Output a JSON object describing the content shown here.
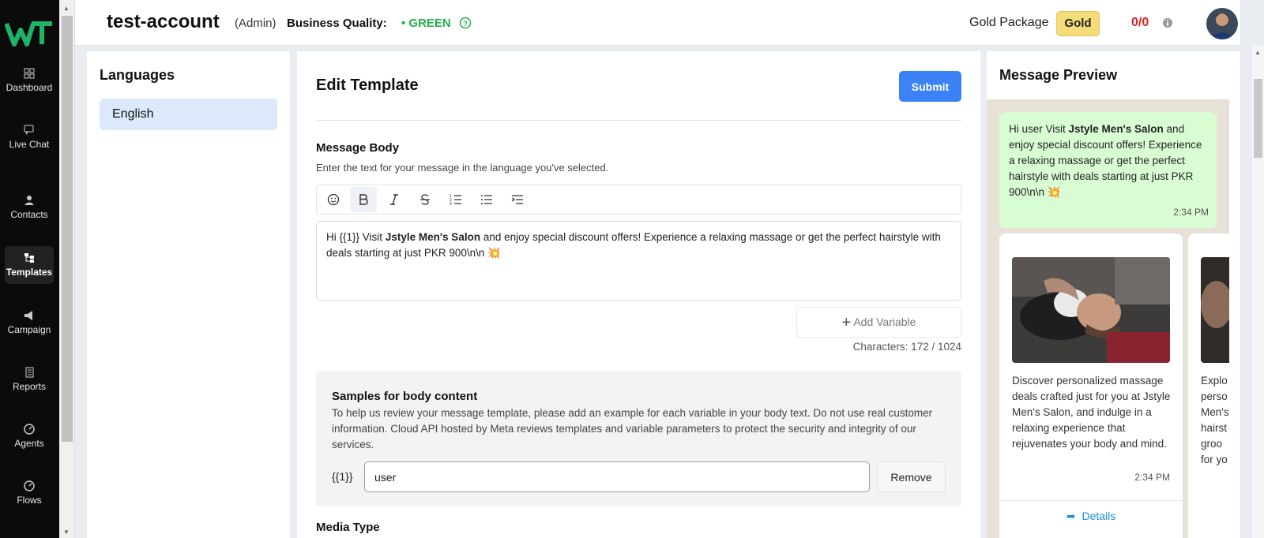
{
  "sidebar": {
    "logo_text": "WT",
    "items": [
      {
        "label": "Dashboard",
        "icon": "dashboard-icon"
      },
      {
        "label": "Live Chat",
        "icon": "chat-icon"
      },
      {
        "label": "Contacts",
        "icon": "user-icon"
      },
      {
        "label": "Templates",
        "icon": "templates-icon",
        "active": true
      },
      {
        "label": "Campaign",
        "icon": "megaphone-icon"
      },
      {
        "label": "Reports",
        "icon": "reports-icon"
      },
      {
        "label": "Agents",
        "icon": "gauge-icon"
      },
      {
        "label": "Flows",
        "icon": "gauge-icon"
      }
    ]
  },
  "header": {
    "account_name": "test-account",
    "role": "(Admin)",
    "business_quality_label": "Business Quality:",
    "business_quality_value": "• GREEN",
    "package_label": "Gold Package",
    "package_badge": "Gold",
    "quota": "0/0"
  },
  "languages": {
    "title": "Languages",
    "items": [
      "English"
    ]
  },
  "edit": {
    "title": "Edit Template",
    "submit_label": "Submit",
    "message_body_title": "Message Body",
    "message_body_desc": "Enter the text for your message in the language you've selected.",
    "body_before": "Hi {{1}} Visit ",
    "body_bold": "Jstyle Men's Salon",
    "body_after": " and enjoy special discount offers! Experience a relaxing massage or get the perfect hairstyle with deals starting at just PKR 900\\n\\n 💥",
    "add_variable_label": "Add Variable",
    "characters": "Characters: 172 / 1024",
    "samples_title": "Samples for body content",
    "samples_desc": "To help us review your message template, please add an example for each variable in your body text. Do not use real customer information. Cloud API hosted by Meta reviews templates and variable parameters to protect the security and integrity of our services.",
    "variable_label": "{{1}}",
    "variable_value": "user",
    "remove_label": "Remove",
    "media_type_title": "Media Type"
  },
  "preview": {
    "title": "Message Preview",
    "bubble_before": "Hi user Visit ",
    "bubble_bold": "Jstyle Men's Salon",
    "bubble_after": " and enjoy special discount offers! Experience a relaxing massage or get the perfect hairstyle with deals starting at just PKR 900\\n\\n 💥",
    "bubble_time": "2:34 PM",
    "cards": [
      {
        "text": "Discover personalized massage deals crafted just for you at Jstyle Men's Salon, and indulge in a relaxing experience that rejuvenates your body and mind.",
        "time": "2:34 PM",
        "button": "Details"
      },
      {
        "text": "Explo perso Men's hairst groo for yo"
      }
    ]
  },
  "colors": {
    "accent": "#3b82f6",
    "quality_green": "#22b14c",
    "quota_red": "#e02424",
    "bubble": "#d9fdd3"
  }
}
